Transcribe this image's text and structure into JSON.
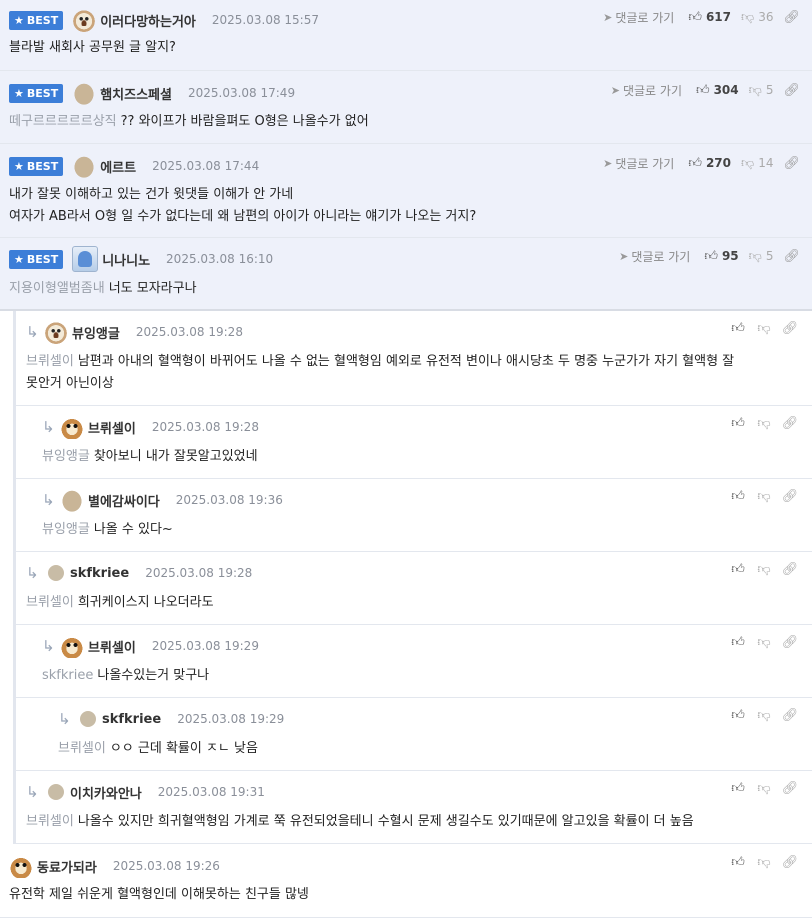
{
  "goto_label": "댓글로 가기",
  "best_label": "BEST",
  "comments": [
    {
      "name": "이러다망하는거아",
      "date": "2025.03.08 15:57",
      "up": "617",
      "down": "36",
      "lines": [
        "블라발 새회사 공무원 글 알지?"
      ],
      "tag": ""
    },
    {
      "name": "햄치즈스페셜",
      "date": "2025.03.08 17:49",
      "up": "304",
      "down": "5",
      "tag": "떼구르르르르르상직",
      "lines": [
        "?? 와이프가 바람을펴도 O형은 나올수가 없어"
      ]
    },
    {
      "name": "에르트",
      "date": "2025.03.08 17:44",
      "up": "270",
      "down": "14",
      "tag": "",
      "lines": [
        "내가 잘못 이해하고 있는 건가 윗댓들 이해가 안 가네",
        "여자가 AB라서 O형 일 수가 없다는데 왜 남편의 아이가 아니라는 얘기가 나오는 거지?"
      ]
    },
    {
      "name": "니나니노",
      "date": "2025.03.08 16:10",
      "up": "95",
      "down": "5",
      "tag": "지용이형앨범좀내",
      "lines": [
        "너도 모자라구나"
      ]
    },
    {
      "name": "뷰잉앵글",
      "date": "2025.03.08 19:28",
      "tag": "브뤼셀이",
      "lines": [
        "남편과 아내의 혈액형이 바뀌어도 나올 수 없는 혈액형임 예외로 유전적 변이나 애시당초 두 명중 누군가가 자기 혈액형 잘",
        "못안거 아닌이상"
      ]
    },
    {
      "name": "브뤼셀이",
      "date": "2025.03.08 19:28",
      "tag": "뷰잉앵글",
      "lines": [
        "찾아보니 내가 잘못알고있었네"
      ]
    },
    {
      "name": "별에감싸이다",
      "date": "2025.03.08 19:36",
      "tag": "뷰잉앵글",
      "lines": [
        "나올 수 있다~"
      ]
    },
    {
      "name": "skfkriee",
      "date": "2025.03.08 19:28",
      "tag": "브뤼셀이",
      "lines": [
        "희귀케이스지 나오더라도"
      ]
    },
    {
      "name": "브뤼셀이",
      "date": "2025.03.08 19:29",
      "tag": "skfkriee",
      "lines": [
        "나올수있는거 맞구나"
      ]
    },
    {
      "name": "skfkriee",
      "date": "2025.03.08 19:29",
      "tag": "브뤼셀이",
      "lines": [
        "ㅇㅇ 근데 확률이 ㅈㄴ 낮음"
      ]
    },
    {
      "name": "이치카와안나",
      "date": "2025.03.08 19:31",
      "tag": "브뤼셀이",
      "lines": [
        "나올수 있지만 희귀혈액형임 가계로 쭉 유전되었을테니 수혈시 문제 생길수도 있기때문에 알고있을 확률이 더 높음"
      ]
    },
    {
      "name": "동료가되라",
      "date": "2025.03.08 19:26",
      "tag": "",
      "lines": [
        "유전학 제일 쉬운게 혈액형인데 이해못하는 친구들 많넹"
      ]
    }
  ]
}
